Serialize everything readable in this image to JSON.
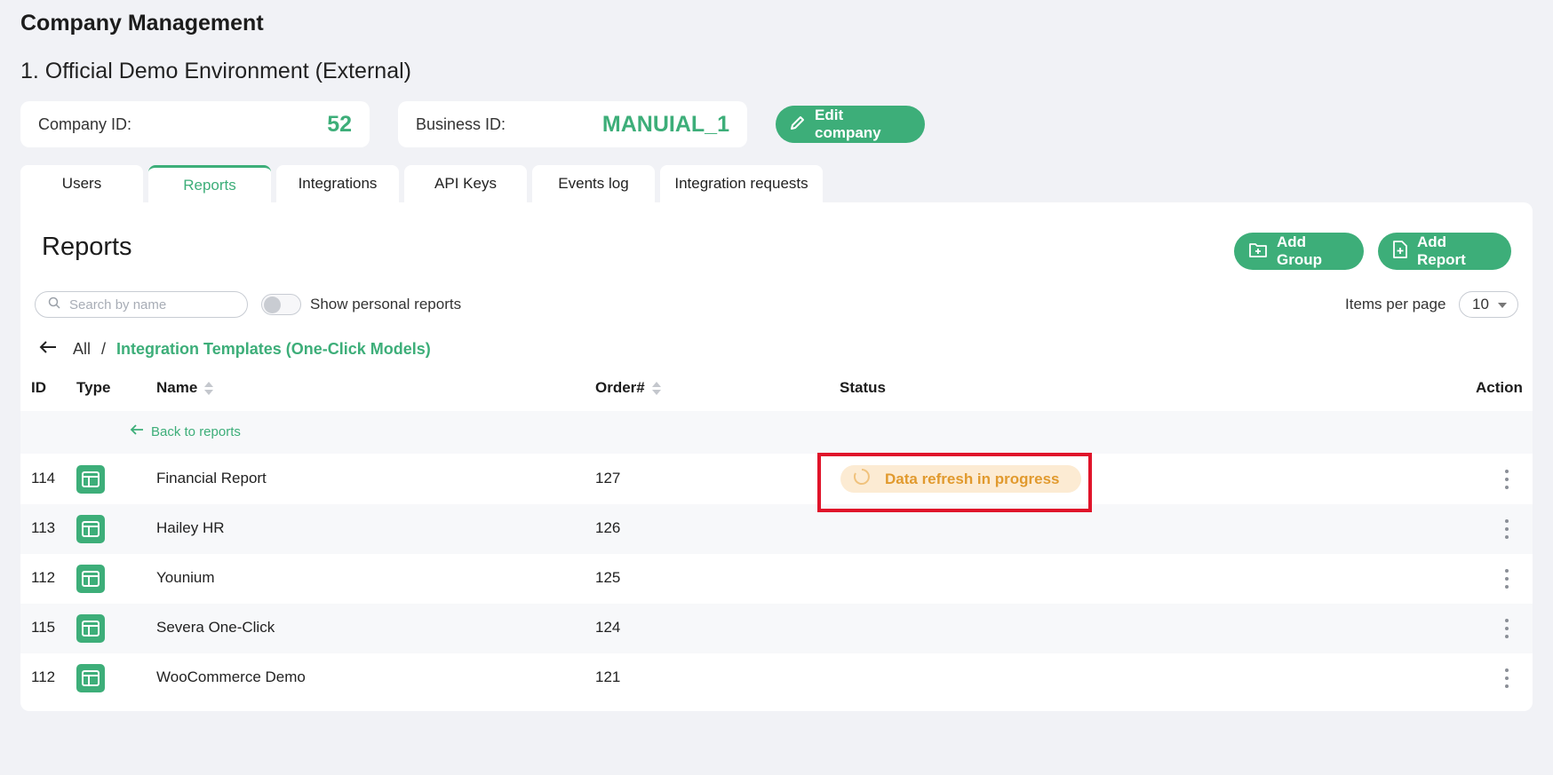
{
  "header": {
    "title": "Company Management",
    "company_name": "1. Official Demo Environment (External)",
    "company_id_label": "Company ID:",
    "company_id_value": "52",
    "business_id_label": "Business ID:",
    "business_id_value": "MANUIAL_1",
    "edit_button": "Edit company"
  },
  "tabs": [
    {
      "label": "Users",
      "active": false
    },
    {
      "label": "Reports",
      "active": true
    },
    {
      "label": "Integrations",
      "active": false
    },
    {
      "label": "API Keys",
      "active": false
    },
    {
      "label": "Events log",
      "active": false
    },
    {
      "label": "Integration requests",
      "active": false
    }
  ],
  "reports": {
    "title": "Reports",
    "add_group": "Add Group",
    "add_report": "Add Report",
    "search_placeholder": "Search by name",
    "toggle_label": "Show personal reports",
    "toggle_on": false,
    "items_per_page_label": "Items per page",
    "items_per_page_value": "10",
    "breadcrumb": {
      "root": "All",
      "separator": "/",
      "current": "Integration Templates (One-Click Models)"
    },
    "columns": {
      "id": "ID",
      "type": "Type",
      "name": "Name",
      "order": "Order#",
      "status": "Status",
      "action": "Action"
    },
    "back_link": "Back to reports",
    "rows": [
      {
        "id": "114",
        "name": "Financial Report",
        "order": "127",
        "status": "Data refresh in progress"
      },
      {
        "id": "113",
        "name": "Hailey HR",
        "order": "126",
        "status": ""
      },
      {
        "id": "112",
        "name": "Younium",
        "order": "125",
        "status": ""
      },
      {
        "id": "115",
        "name": "Severa One-Click",
        "order": "124",
        "status": ""
      },
      {
        "id": "112",
        "name": "WooCommerce Demo",
        "order": "121",
        "status": ""
      }
    ]
  },
  "colors": {
    "accent": "#3dae79",
    "status_warning_bg": "#fcebd3",
    "status_warning_text": "#e19a2e",
    "highlight": "#e0142a"
  }
}
